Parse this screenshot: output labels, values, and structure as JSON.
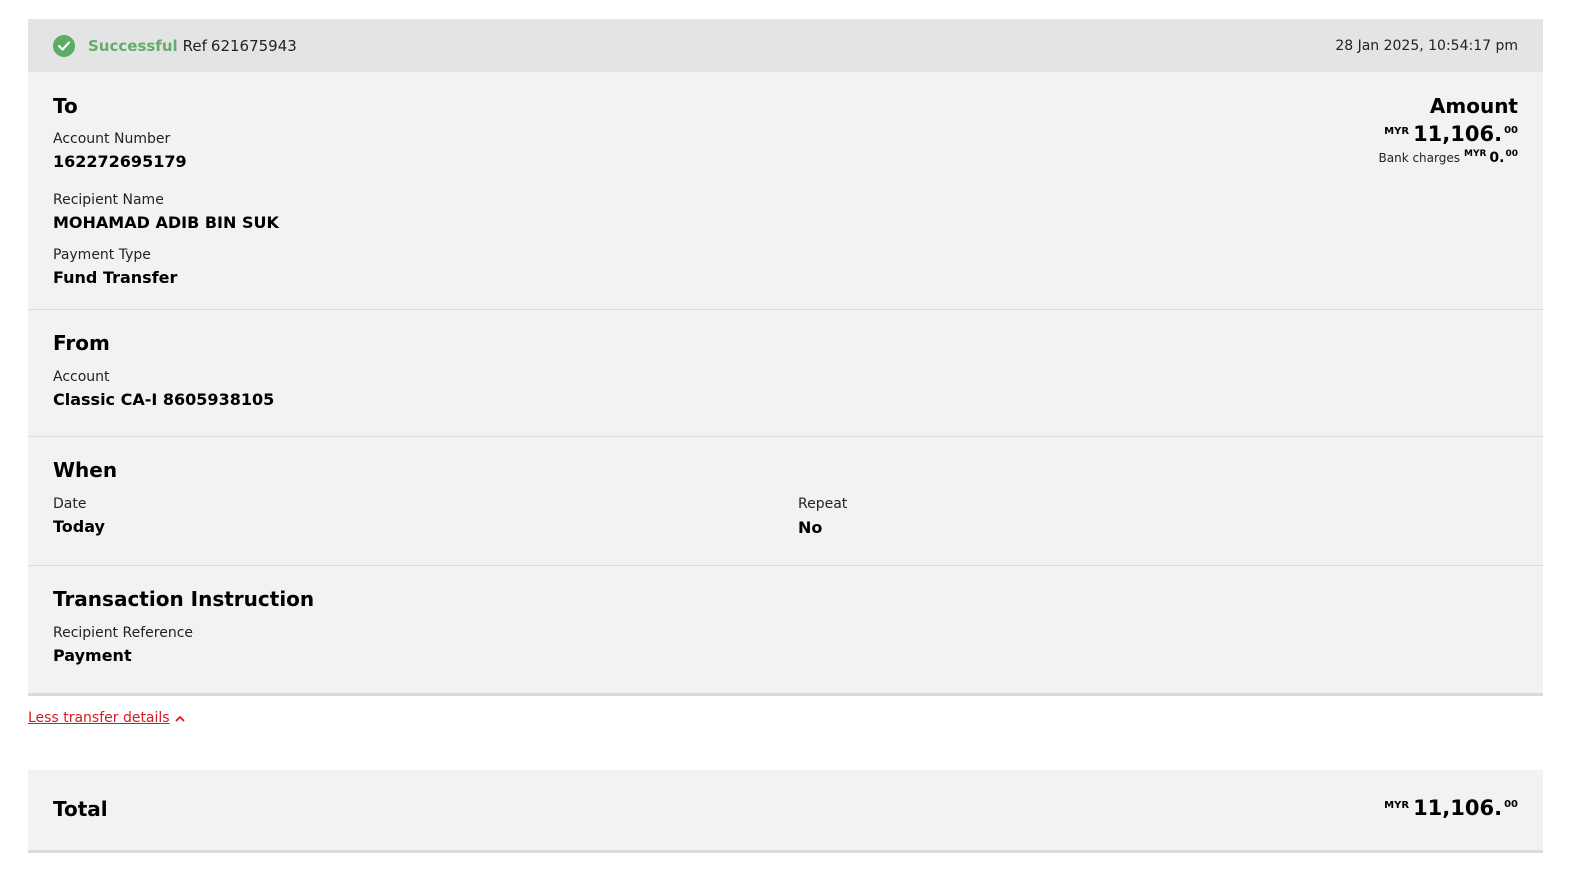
{
  "status": {
    "state": "Successful",
    "ref_label": "Ref",
    "ref_number": "621675943",
    "timestamp": "28 Jan 2025, 10:54:17 pm"
  },
  "to": {
    "title": "To",
    "account_number_label": "Account Number",
    "account_number": "162272695179",
    "recipient_name_label": "Recipient Name",
    "recipient_name": "MOHAMAD ADIB BIN SUK",
    "payment_type_label": "Payment Type",
    "payment_type": "Fund Transfer"
  },
  "amount": {
    "title": "Amount",
    "currency": "MYR",
    "main": "11,106.",
    "decimals": "00",
    "charges_label": "Bank charges",
    "charges_currency": "MYR",
    "charges_main": "0.",
    "charges_decimals": "00"
  },
  "from": {
    "title": "From",
    "account_label": "Account",
    "account": "Classic CA-I 8605938105"
  },
  "when": {
    "title": "When",
    "date_label": "Date",
    "date": "Today",
    "repeat_label": "Repeat",
    "repeat": "No"
  },
  "instruction": {
    "title": "Transaction Instruction",
    "reference_label": "Recipient Reference",
    "reference": "Payment"
  },
  "toggle": {
    "label": "Less transfer details"
  },
  "total": {
    "label": "Total",
    "currency": "MYR",
    "main": "11,106.",
    "decimals": "00"
  },
  "colors": {
    "success": "#63ad6c",
    "link": "#d71920",
    "card_bg": "#f2f2f2",
    "header_bg": "#e4e4e4"
  },
  "icons": {
    "status": "check-circle-icon",
    "toggle": "chevron-up-icon"
  }
}
